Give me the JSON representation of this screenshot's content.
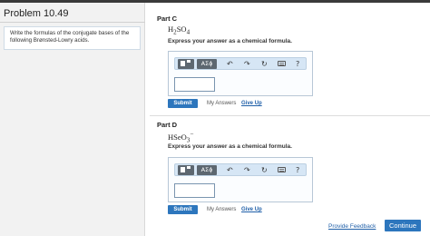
{
  "problem": {
    "title": "Problem 10.49",
    "intro": "Write the formulas of the conjugate bases of the following Brønsted-Lowry acids."
  },
  "parts": [
    {
      "label": "Part C",
      "formula_html": "H<sub>2</sub>SO<sub>4</sub>",
      "instruction": "Express your answer as a chemical formula.",
      "symbol_button": "ΑΣϕ",
      "answer_value": "",
      "submit_label": "Submit",
      "my_answers_label": "My Answers",
      "give_up_label": "Give Up"
    },
    {
      "label": "Part D",
      "formula_html": "HSeO<sub>3</sub><sup>−</sup>",
      "instruction": "Express your answer as a chemical formula.",
      "symbol_button": "ΑΣϕ",
      "answer_value": "",
      "submit_label": "Submit",
      "my_answers_label": "My Answers",
      "give_up_label": "Give Up"
    }
  ],
  "footer": {
    "provide_feedback": "Provide Feedback",
    "continue_label": "Continue"
  },
  "icons": {
    "undo": "undo-icon",
    "redo": "redo-icon",
    "reset": "reset-icon",
    "keyboard": "keyboard-icon",
    "help": "help-icon",
    "template": "template-icon"
  },
  "colors": {
    "accent": "#2d76bd",
    "link": "#1f5fa8",
    "toolbar_bg": "#d6e6f5"
  }
}
